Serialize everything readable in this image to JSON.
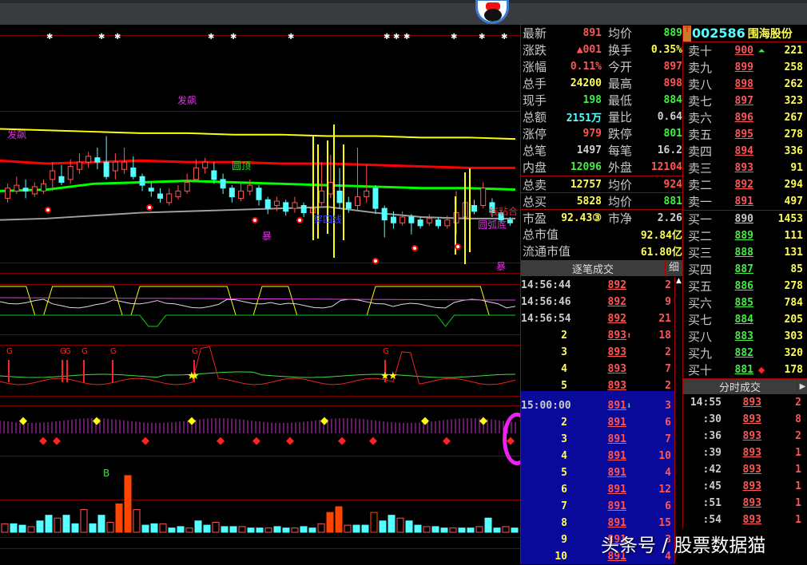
{
  "stock": {
    "code": "002586",
    "name": "围海股份",
    "t_badge": "T"
  },
  "stats": [
    {
      "k": "最新",
      "v": "891",
      "vc": "red",
      "k2": "均价",
      "v2": "889",
      "v2c": "grn"
    },
    {
      "k": "涨跌",
      "v": "▲001",
      "vc": "red",
      "k2": "换手",
      "v2": "0.35%",
      "v2c": "yel"
    },
    {
      "k": "涨幅",
      "v": "0.11%",
      "vc": "red",
      "k2": "今开",
      "v2": "897",
      "v2c": "red"
    },
    {
      "k": "总手",
      "v": "24200",
      "vc": "yel",
      "k2": "最高",
      "v2": "898",
      "v2c": "red"
    },
    {
      "k": "现手",
      "v": "198",
      "vc": "grn",
      "k2": "最低",
      "v2": "884",
      "v2c": "grn"
    },
    {
      "k": "总额",
      "v": "2151万",
      "vc": "cyn",
      "k2": "量比",
      "v2": "0.64",
      "v2c": "wht"
    },
    {
      "k": "涨停",
      "v": "979",
      "vc": "red",
      "k2": "跌停",
      "v2": "801",
      "v2c": "grn"
    },
    {
      "k": "总笔",
      "v": "1497",
      "vc": "wht",
      "k2": "每笔",
      "v2": "16.2",
      "v2c": "wht"
    },
    {
      "k": "内盘",
      "v": "12096",
      "vc": "grn",
      "k2": "外盘",
      "v2": "12104",
      "v2c": "red"
    },
    {
      "k": "总卖",
      "v": "12757",
      "vc": "yel",
      "k2": "均价",
      "v2": "924",
      "v2c": "red"
    },
    {
      "k": "总买",
      "v": "5828",
      "vc": "yel",
      "k2": "均价",
      "v2": "881",
      "v2c": "grn"
    },
    {
      "k": "市盈",
      "v": "92.43③",
      "vc": "yel",
      "k2": "市净",
      "v2": "2.26",
      "v2c": "wht"
    }
  ],
  "stats_wide": [
    {
      "k": "总市值",
      "v": "92.84亿"
    },
    {
      "k": "流通市值",
      "v": "61.80亿"
    }
  ],
  "tick_panel": {
    "title": "逐笔成交",
    "detail_btn": "细",
    "scroll_up": "▲"
  },
  "ticks": [
    {
      "t": "14:56:44",
      "p": "892",
      "a": "",
      "v": "2",
      "vc": "grn"
    },
    {
      "t": "14:56:46",
      "p": "892",
      "a": "",
      "v": "9",
      "vc": "red"
    },
    {
      "t": "14:56:54",
      "p": "892",
      "a": "",
      "v": "21",
      "vc": "red"
    },
    {
      "t": "2",
      "p": "893",
      "a": "⬆",
      "v": "18",
      "vc": "red"
    },
    {
      "t": "3",
      "p": "893",
      "a": "",
      "v": "2",
      "vc": "red"
    },
    {
      "t": "4",
      "p": "893",
      "a": "",
      "v": "7",
      "vc": "red"
    },
    {
      "t": "5",
      "p": "893",
      "a": "",
      "v": "2",
      "vc": "red"
    },
    {
      "t": "15:00:00",
      "p": "891",
      "a": "⬇",
      "v": "3",
      "vc": "red"
    },
    {
      "t": "2",
      "p": "891",
      "a": "",
      "v": "6",
      "vc": "red"
    },
    {
      "t": "3",
      "p": "891",
      "a": "",
      "v": "7",
      "vc": "red"
    },
    {
      "t": "4",
      "p": "891",
      "a": "",
      "v": "10",
      "vc": "red"
    },
    {
      "t": "5",
      "p": "891",
      "a": "",
      "v": "4",
      "vc": "red"
    },
    {
      "t": "6",
      "p": "891",
      "a": "",
      "v": "12",
      "vc": "red"
    },
    {
      "t": "7",
      "p": "891",
      "a": "",
      "v": "6",
      "vc": "red"
    },
    {
      "t": "8",
      "p": "891",
      "a": "",
      "v": "15",
      "vc": "red"
    },
    {
      "t": "9",
      "p": "891",
      "a": "",
      "v": "3",
      "vc": "red"
    },
    {
      "t": "10",
      "p": "891",
      "a": "",
      "v": "4",
      "vc": "red"
    }
  ],
  "sell": [
    {
      "k": "卖十",
      "p": "900",
      "m": "⏶",
      "q": "221"
    },
    {
      "k": "卖九",
      "p": "899",
      "m": "",
      "q": "258"
    },
    {
      "k": "卖八",
      "p": "898",
      "m": "",
      "q": "262"
    },
    {
      "k": "卖七",
      "p": "897",
      "m": "",
      "q": "323"
    },
    {
      "k": "卖六",
      "p": "896",
      "m": "",
      "q": "267"
    },
    {
      "k": "卖五",
      "p": "895",
      "m": "",
      "q": "278"
    },
    {
      "k": "卖四",
      "p": "894",
      "m": "",
      "q": "336"
    },
    {
      "k": "卖三",
      "p": "893",
      "m": "",
      "q": "91"
    },
    {
      "k": "卖二",
      "p": "892",
      "m": "",
      "q": "294"
    },
    {
      "k": "卖一",
      "p": "891",
      "m": "",
      "q": "497"
    }
  ],
  "buy": [
    {
      "k": "买一",
      "p": "890",
      "m": "",
      "q": "1453"
    },
    {
      "k": "买二",
      "p": "889",
      "m": "",
      "q": "111"
    },
    {
      "k": "买三",
      "p": "888",
      "m": "",
      "q": "131"
    },
    {
      "k": "买四",
      "p": "887",
      "m": "",
      "q": "85"
    },
    {
      "k": "买五",
      "p": "886",
      "m": "",
      "q": "278"
    },
    {
      "k": "买六",
      "p": "885",
      "m": "",
      "q": "784"
    },
    {
      "k": "买七",
      "p": "884",
      "m": "",
      "q": "205"
    },
    {
      "k": "买八",
      "p": "883",
      "m": "",
      "q": "303"
    },
    {
      "k": "买九",
      "p": "882",
      "m": "",
      "q": "320"
    },
    {
      "k": "买十",
      "p": "881",
      "m": "◆",
      "q": "178"
    }
  ],
  "minute_panel": {
    "title": "分时成交",
    "arrow": "▶"
  },
  "minutes": [
    {
      "t": "14:55",
      "p": "893",
      "v": "2"
    },
    {
      "t": ":30",
      "p": "893",
      "v": "8"
    },
    {
      "t": ":36",
      "p": "893",
      "v": "2"
    },
    {
      "t": ":39",
      "p": "893",
      "v": "1"
    },
    {
      "t": ":42",
      "p": "893",
      "v": "1"
    },
    {
      "t": ":45",
      "p": "893",
      "v": "1"
    },
    {
      "t": ":51",
      "p": "893",
      "v": "1"
    },
    {
      "t": ":54",
      "p": "893",
      "v": "1"
    }
  ],
  "watermark": "头条号 / 股票数据猫",
  "chart_labels": [
    {
      "text": "发飙",
      "color": "#dd33dd"
    },
    {
      "text": "发飙",
      "color": "#dd33dd"
    },
    {
      "text": "圆顶",
      "color": "#33dd33"
    },
    {
      "text": "暴",
      "color": "#dd33dd"
    },
    {
      "text": "暴",
      "color": "#dd33dd"
    },
    {
      "text": "穿四线",
      "color": "#2233ee"
    },
    {
      "text": "线粘合",
      "color": "#ee2222"
    },
    {
      "text": "圆弧底",
      "color": "#dd33dd"
    }
  ],
  "colors": {
    "up": "#ff5555",
    "down": "#55ffff",
    "ma1": "#ffff00",
    "ma2": "#ff0000",
    "ma3": "#00ff00",
    "ma4": "#a0a0a0",
    "grid": "#800000"
  },
  "chart_data": {
    "type": "candlestick",
    "ylim": [
      8.6,
      10.2
    ],
    "candles": [
      [
        9.05,
        9.12,
        9.15,
        9.02
      ],
      [
        9.1,
        9.14,
        9.2,
        9.08
      ],
      [
        9.12,
        9.1,
        9.18,
        9.05
      ],
      [
        9.08,
        9.13,
        9.16,
        9.06
      ],
      [
        9.1,
        9.15,
        9.18,
        9.08
      ],
      [
        9.18,
        9.24,
        9.3,
        9.1
      ],
      [
        9.2,
        9.16,
        9.28,
        9.14
      ],
      [
        9.18,
        9.27,
        9.32,
        9.15
      ],
      [
        9.25,
        9.3,
        9.36,
        9.22
      ],
      [
        9.3,
        9.34,
        9.37,
        9.26
      ],
      [
        9.33,
        9.3,
        9.4,
        9.25
      ],
      [
        9.3,
        9.2,
        9.48,
        9.18
      ],
      [
        9.24,
        9.3,
        9.36,
        9.18
      ],
      [
        9.25,
        9.3,
        9.4,
        9.22
      ],
      [
        9.26,
        9.2,
        9.34,
        9.18
      ],
      [
        9.2,
        9.14,
        9.22,
        9.1
      ],
      [
        9.12,
        9.1,
        9.16,
        9.06
      ],
      [
        9.08,
        9.05,
        9.12,
        9.02
      ],
      [
        9.02,
        9.08,
        9.12,
        9.0
      ],
      [
        9.06,
        9.1,
        9.14,
        9.04
      ],
      [
        9.1,
        9.16,
        9.22,
        9.08
      ],
      [
        9.18,
        9.26,
        9.32,
        9.16
      ],
      [
        9.26,
        9.3,
        9.33,
        9.22
      ],
      [
        9.24,
        9.18,
        9.3,
        9.15
      ],
      [
        9.18,
        9.12,
        9.22,
        9.08
      ],
      [
        9.12,
        9.06,
        9.14,
        9.02
      ],
      [
        9.05,
        9.1,
        9.16,
        9.03
      ],
      [
        9.1,
        9.14,
        9.18,
        9.07
      ],
      [
        9.12,
        9.04,
        9.14,
        9.0
      ],
      [
        9.04,
        8.98,
        9.06,
        8.94
      ],
      [
        9.0,
        9.03,
        9.06,
        8.96
      ],
      [
        9.02,
        8.96,
        9.04,
        8.93
      ],
      [
        8.98,
        9.02,
        9.06,
        8.95
      ],
      [
        9.0,
        8.95,
        9.02,
        8.92
      ],
      [
        8.95,
        8.98,
        9.02,
        8.93
      ],
      [
        9.02,
        9.1,
        9.3,
        9.0
      ],
      [
        9.08,
        9.16,
        9.35,
        9.05
      ],
      [
        9.1,
        9.02,
        9.26,
        8.98
      ],
      [
        9.02,
        8.98,
        9.06,
        8.95
      ],
      [
        9.0,
        9.06,
        9.4,
        8.96
      ],
      [
        9.06,
        9.1,
        9.28,
        9.02
      ],
      [
        9.12,
        8.98,
        9.14,
        8.94
      ],
      [
        8.98,
        8.9,
        9.0,
        8.78
      ],
      [
        8.92,
        8.88,
        8.96,
        8.84
      ],
      [
        8.88,
        8.92,
        8.96,
        8.86
      ],
      [
        8.92,
        8.88,
        8.94,
        8.8
      ],
      [
        8.9,
        8.86,
        8.92,
        8.84
      ],
      [
        8.88,
        8.91,
        8.94,
        8.86
      ],
      [
        8.9,
        8.86,
        8.92,
        8.84
      ],
      [
        8.86,
        8.9,
        8.93,
        8.84
      ],
      [
        8.88,
        8.95,
        9.1,
        8.8
      ],
      [
        8.92,
        9.02,
        9.18,
        8.85
      ],
      [
        9.0,
        8.96,
        9.04,
        8.94
      ],
      [
        9.0,
        9.12,
        9.16,
        8.98
      ],
      [
        9.02,
        8.95,
        9.05,
        8.92
      ],
      [
        8.95,
        8.9,
        8.97,
        8.88
      ],
      [
        8.9,
        8.88,
        8.92,
        8.86
      ]
    ],
    "ma_lines": [
      {
        "name": "MA1",
        "values": [
          9.53,
          9.52,
          9.51,
          9.5,
          9.5,
          9.49,
          9.49,
          9.48,
          9.48,
          9.47,
          9.47,
          9.46
        ]
      },
      {
        "name": "MA2",
        "values": [
          9.31,
          9.29,
          9.3,
          9.31,
          9.3,
          9.3,
          9.29,
          9.29,
          9.28,
          9.27,
          9.26,
          9.26
        ]
      },
      {
        "name": "MA3",
        "values": [
          9.1,
          9.11,
          9.15,
          9.16,
          9.17,
          9.16,
          9.15,
          9.14,
          9.13,
          9.12,
          9.12,
          9.11
        ]
      },
      {
        "name": "MA4",
        "values": [
          8.9,
          8.91,
          8.93,
          8.95,
          8.96,
          8.97,
          8.98,
          8.99,
          8.95,
          8.92,
          8.91,
          8.91
        ]
      }
    ],
    "volume": [
      6,
      6,
      5,
      4,
      8,
      12,
      10,
      12,
      6,
      16,
      6,
      12,
      7,
      20,
      40,
      16,
      5,
      6,
      6,
      3,
      4,
      3,
      8,
      5,
      7,
      4,
      4,
      4,
      3,
      3,
      3,
      4,
      3,
      3,
      4,
      3,
      6,
      14,
      18,
      5,
      5,
      5,
      14,
      8,
      12,
      10,
      8,
      5,
      4,
      4,
      3,
      3,
      3,
      3,
      4,
      10,
      3,
      4,
      3
    ]
  }
}
